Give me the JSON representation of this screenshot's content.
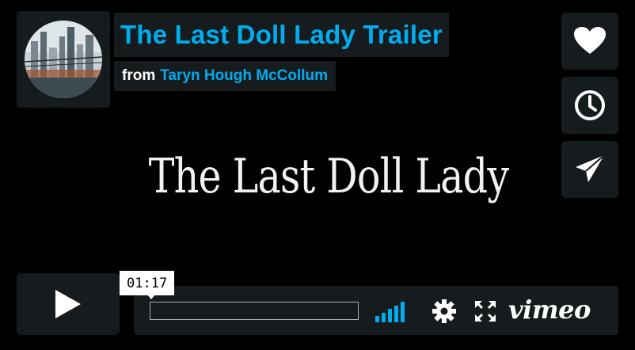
{
  "header": {
    "title": "The Last Doll Lady Trailer",
    "byline_prefix": "from",
    "author": "Taryn Hough McCollum"
  },
  "video": {
    "title_card_text": "The Last Doll Lady"
  },
  "side_buttons": [
    {
      "name": "like-button",
      "icon": "heart-icon"
    },
    {
      "name": "watch-later-button",
      "icon": "clock-icon"
    },
    {
      "name": "share-button",
      "icon": "paper-plane-icon"
    }
  ],
  "controls": {
    "play_icon": "play-icon",
    "timecode": "01:17",
    "progress": 0,
    "volume_bars": 5,
    "settings_icon": "gear-icon",
    "fullscreen_icon": "fullscreen-icon",
    "logo_text": "vimeo"
  },
  "colors": {
    "accent": "#00adef",
    "panel": "#161b1d",
    "background": "#000000",
    "text": "#ffffff"
  }
}
